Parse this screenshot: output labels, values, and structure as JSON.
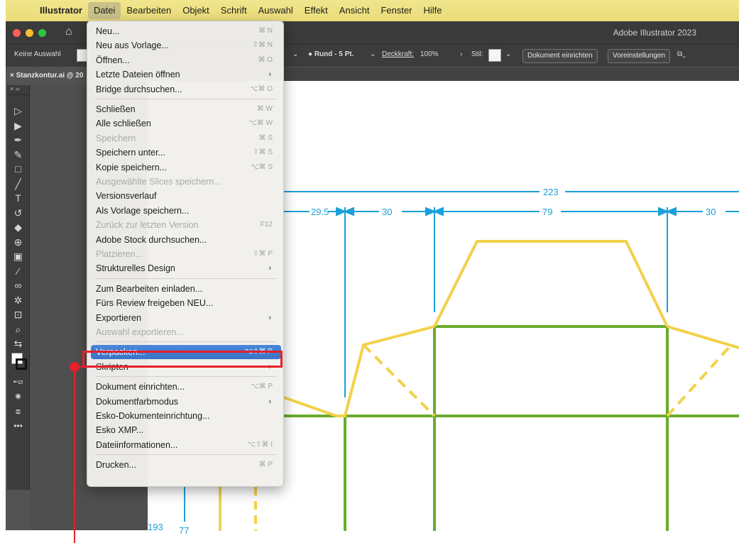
{
  "menubar": {
    "app": "Illustrator",
    "items": [
      "Datei",
      "Bearbeiten",
      "Objekt",
      "Schrift",
      "Auswahl",
      "Effekt",
      "Ansicht",
      "Fenster",
      "Hilfe"
    ]
  },
  "window": {
    "title": "Adobe Illustrator 2023"
  },
  "control_bar": {
    "selection": "Keine Auswahl",
    "stroke_profile": "Rund - 5 Pt.",
    "opacity_label": "Deckkraft:",
    "opacity_value": "100%",
    "style_label": "Stil:",
    "document_setup_button": "Dokument einrichten",
    "preferences_button": "Voreinstellungen"
  },
  "document_tab": {
    "label": "Stanzkontur.ai @ 20"
  },
  "file_menu": {
    "items": [
      {
        "label": "Neu...",
        "shortcut": "⌘ N"
      },
      {
        "label": "Neu aus Vorlage...",
        "shortcut": "⇧⌘ N"
      },
      {
        "label": "Öffnen...",
        "shortcut": "⌘ O"
      },
      {
        "label": "Letzte Dateien öffnen",
        "submenu": true
      },
      {
        "label": "Bridge durchsuchen...",
        "shortcut": "⌥⌘ O"
      },
      {
        "separator": true
      },
      {
        "label": "Schließen",
        "shortcut": "⌘ W"
      },
      {
        "label": "Alle schließen",
        "shortcut": "⌥⌘ W"
      },
      {
        "label": "Speichern",
        "shortcut": "⌘ S",
        "disabled": true
      },
      {
        "label": "Speichern unter...",
        "shortcut": "⇧⌘ S"
      },
      {
        "label": "Kopie speichern...",
        "shortcut": "⌥⌘ S"
      },
      {
        "label": "Ausgewählte Slices speichern...",
        "disabled": true
      },
      {
        "label": "Versionsverlauf"
      },
      {
        "label": "Als Vorlage speichern..."
      },
      {
        "label": "Zurück zur letzten Version",
        "shortcut": "F12",
        "disabled": true
      },
      {
        "label": "Adobe Stock durchsuchen..."
      },
      {
        "label": "Platzieren...",
        "shortcut": "⇧⌘ P",
        "disabled": true
      },
      {
        "label": "Strukturelles Design",
        "submenu": true
      },
      {
        "separator": true
      },
      {
        "label": "Zum Bearbeiten einladen..."
      },
      {
        "label": "Fürs Review freigeben NEU..."
      },
      {
        "label": "Exportieren",
        "submenu": true
      },
      {
        "label": "Auswahl exportieren...",
        "disabled": true
      },
      {
        "separator": true
      },
      {
        "label": "Verpacken...",
        "shortcut": "⌥⇧⌘ P",
        "highlighted": true
      },
      {
        "label": "Skripten",
        "submenu": true
      },
      {
        "separator": true
      },
      {
        "label": "Dokument einrichten...",
        "shortcut": "⌥⌘ P"
      },
      {
        "label": "Dokumentfarbmodus",
        "submenu": true
      },
      {
        "label": "Esko-Dokumenteinrichtung..."
      },
      {
        "label": "Esko XMP..."
      },
      {
        "label": "Dateiinformationen...",
        "shortcut": "⌥⇧⌘ I"
      },
      {
        "separator": true
      },
      {
        "label": "Drucken...",
        "shortcut": "⌘ P"
      }
    ]
  },
  "dieline_dimensions": {
    "total_width": "223",
    "segments": [
      "29.5",
      "30",
      "79",
      "30"
    ],
    "bottom": [
      "193",
      "77"
    ]
  },
  "colors": {
    "menubar": "#ede07f",
    "dimension_blue": "#1aa0d8",
    "fold_green": "#6aaa2e",
    "cut_yellow": "#f2d14a",
    "highlight": "#3f7bd0",
    "callout_red": "#e5202a"
  },
  "toolbar_icons": [
    "selection-tool",
    "direct-selection-tool",
    "pen-tool",
    "curvature-tool",
    "rectangle-tool",
    "paintbrush-tool",
    "type-tool",
    "rotate-tool",
    "eraser-tool",
    "shape-builder-tool",
    "gradient-tool",
    "eyedropper-tool",
    "blend-tool",
    "symbol-sprayer-tool",
    "artboard-tool",
    "zoom-tool"
  ]
}
